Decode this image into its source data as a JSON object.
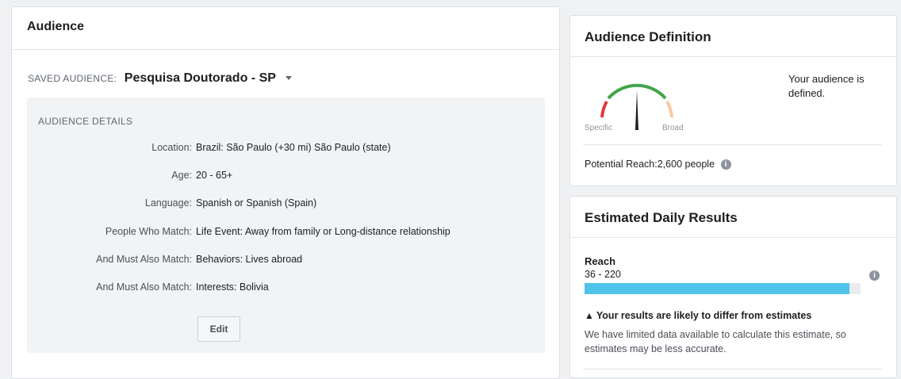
{
  "audience": {
    "title": "Audience",
    "saved_label": "SAVED AUDIENCE:",
    "saved_name": "Pesquisa Doutorado - SP",
    "details_title": "AUDIENCE DETAILS",
    "details": [
      {
        "key": "Location:",
        "value": "Brazil: São Paulo (+30 mi) São Paulo (state)"
      },
      {
        "key": "Age:",
        "value": "20 - 65+"
      },
      {
        "key": "Language:",
        "value": "Spanish or Spanish (Spain)"
      },
      {
        "key": "People Who Match:",
        "value": "Life Event: Away from family or Long-distance relationship"
      },
      {
        "key": "And Must Also Match:",
        "value": "Behaviors: Lives abroad"
      },
      {
        "key": "And Must Also Match:",
        "value": "Interests: Bolivia"
      }
    ],
    "edit_label": "Edit"
  },
  "definition": {
    "title": "Audience Definition",
    "specific_label": "Specific",
    "broad_label": "Broad",
    "status_text": "Your audience is defined.",
    "reach_label": "Potential Reach:",
    "reach_value": "2,600 people",
    "gauge_level": 0.5,
    "colors": {
      "specific": "#e03a3a",
      "mid": "#42a548",
      "broad": "#f7c8a0"
    }
  },
  "estimates": {
    "title": "Estimated Daily Results",
    "reach_label": "Reach",
    "reach_range": "36 - 220",
    "reach_fill": 0.96,
    "bar_color": "#4fc3e8",
    "warning_title": "Your results are likely to differ from estimates",
    "warning_text": "We have limited data available to calculate this estimate, so estimates may be less accurate."
  }
}
